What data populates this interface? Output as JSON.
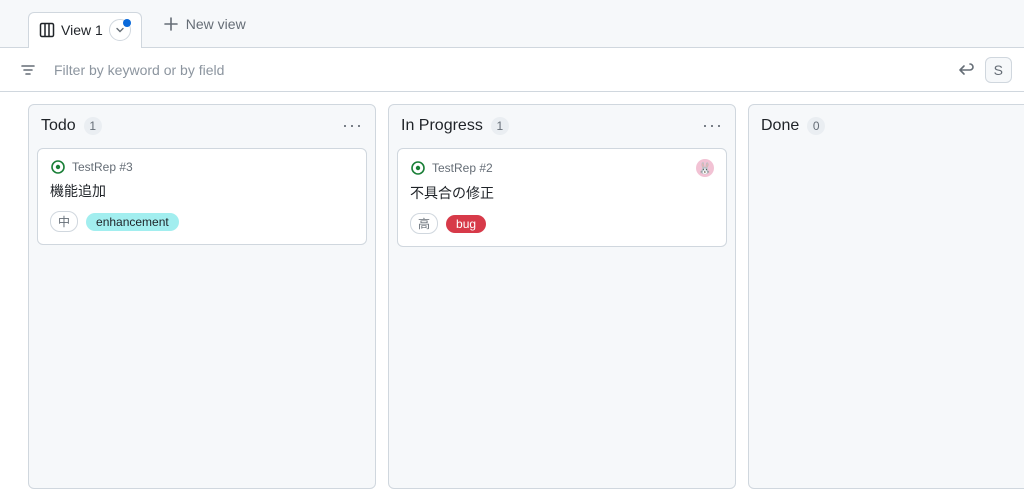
{
  "tabs": {
    "view1": {
      "name": "View 1"
    },
    "newview_label": "New view"
  },
  "filter": {
    "placeholder": "Filter by keyword or by field",
    "save_label": "S"
  },
  "columns": [
    {
      "id": "todo",
      "title": "Todo",
      "count": "1",
      "cards": [
        {
          "repo": "TestRep",
          "number": "#3",
          "title": "機能追加",
          "priority": "中",
          "label": {
            "text": "enhancement",
            "bg": "#a2eeef",
            "fg": "#1f2328"
          },
          "assignee": null
        }
      ]
    },
    {
      "id": "inprogress",
      "title": "In Progress",
      "count": "1",
      "cards": [
        {
          "repo": "TestRep",
          "number": "#2",
          "title": "不具合の修正",
          "priority": "高",
          "label": {
            "text": "bug",
            "bg": "#d73a49",
            "fg": "#ffffff"
          },
          "assignee": {
            "emoji": "🐰",
            "bg": "#f2c2d4"
          }
        }
      ]
    },
    {
      "id": "done",
      "title": "Done",
      "count": "0",
      "cards": []
    }
  ]
}
